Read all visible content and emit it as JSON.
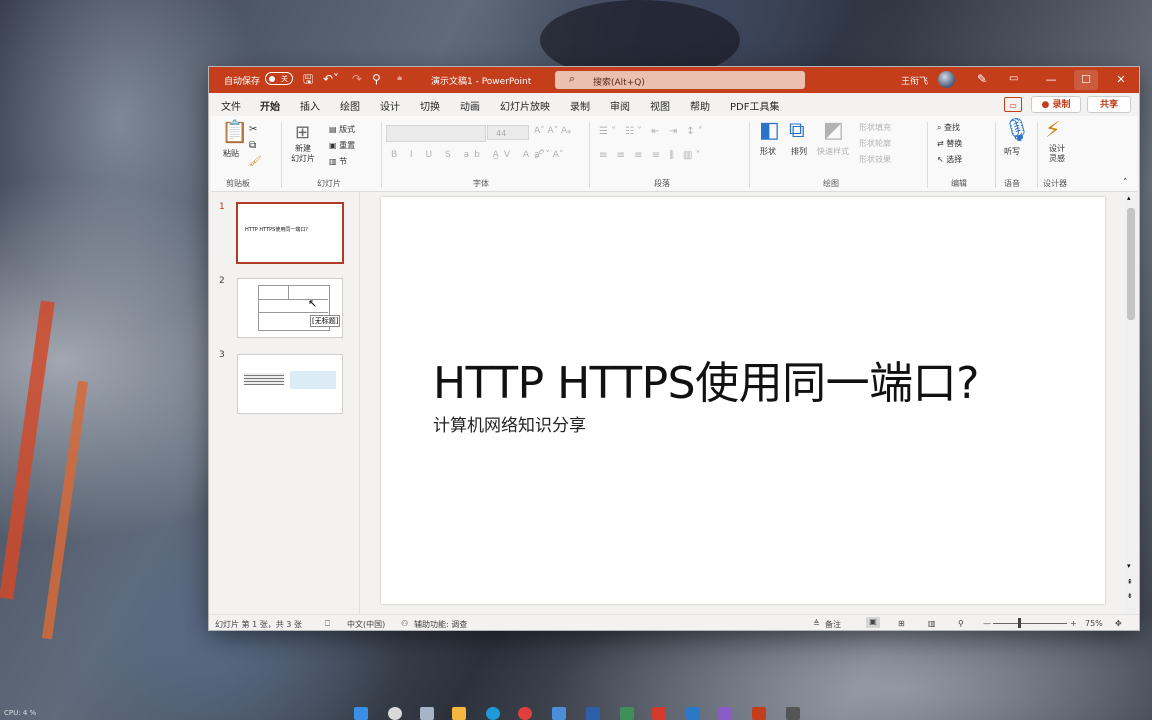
{
  "titlebar": {
    "autosave_label": "自动保存",
    "autosave_state": "关",
    "document": "演示文稿1 - PowerPoint",
    "search_placeholder": "搜索(Alt+Q)",
    "user_name": "王衔飞",
    "accent": "#c43e1c"
  },
  "tabs": [
    {
      "label": "文件"
    },
    {
      "label": "开始"
    },
    {
      "label": "插入"
    },
    {
      "label": "绘图"
    },
    {
      "label": "设计"
    },
    {
      "label": "切换"
    },
    {
      "label": "动画"
    },
    {
      "label": "幻灯片放映"
    },
    {
      "label": "录制"
    },
    {
      "label": "审阅"
    },
    {
      "label": "视图"
    },
    {
      "label": "帮助"
    },
    {
      "label": "PDF工具集"
    }
  ],
  "header_buttons": {
    "record": "● 录制",
    "share": "共享"
  },
  "ribbon": {
    "clipboard": {
      "paste": "粘贴",
      "label": "剪贴板"
    },
    "slides": {
      "new_slide": "新建\n幻灯片",
      "layout": "版式",
      "reset": "重置",
      "section": "节",
      "label": "幻灯片"
    },
    "font": {
      "size": "44",
      "label": "字体"
    },
    "paragraph": {
      "label": "段落"
    },
    "drawing": {
      "shape": "形状",
      "arrange": "排列",
      "quick_styles": "快速样式",
      "fill": "形状填充",
      "outline": "形状轮廓",
      "effects": "形状效果",
      "label": "绘图"
    },
    "editing": {
      "find": "查找",
      "replace": "替换",
      "select": "选择",
      "label": "编辑"
    },
    "voice": {
      "dictate": "听写",
      "label": "语音"
    },
    "designer": {
      "ideas": "设计\n灵感",
      "label": "设计器"
    }
  },
  "thumbnails": [
    {
      "number": "1",
      "title": "HTTP HTTPS使用同一端口?"
    },
    {
      "number": "2",
      "tooltip": "[无标题]"
    },
    {
      "number": "3"
    }
  ],
  "slide": {
    "title": "HTTP HTTPS使用同一端口?",
    "subtitle": "计算机网络知识分享"
  },
  "status": {
    "slide_count": "幻灯片 第 1 张，共 3 张",
    "language": "中文(中国)",
    "accessibility": "辅助功能: 调查",
    "notes": "备注",
    "zoom": "75%"
  },
  "system": {
    "cpu": "CPU: 4 %"
  }
}
